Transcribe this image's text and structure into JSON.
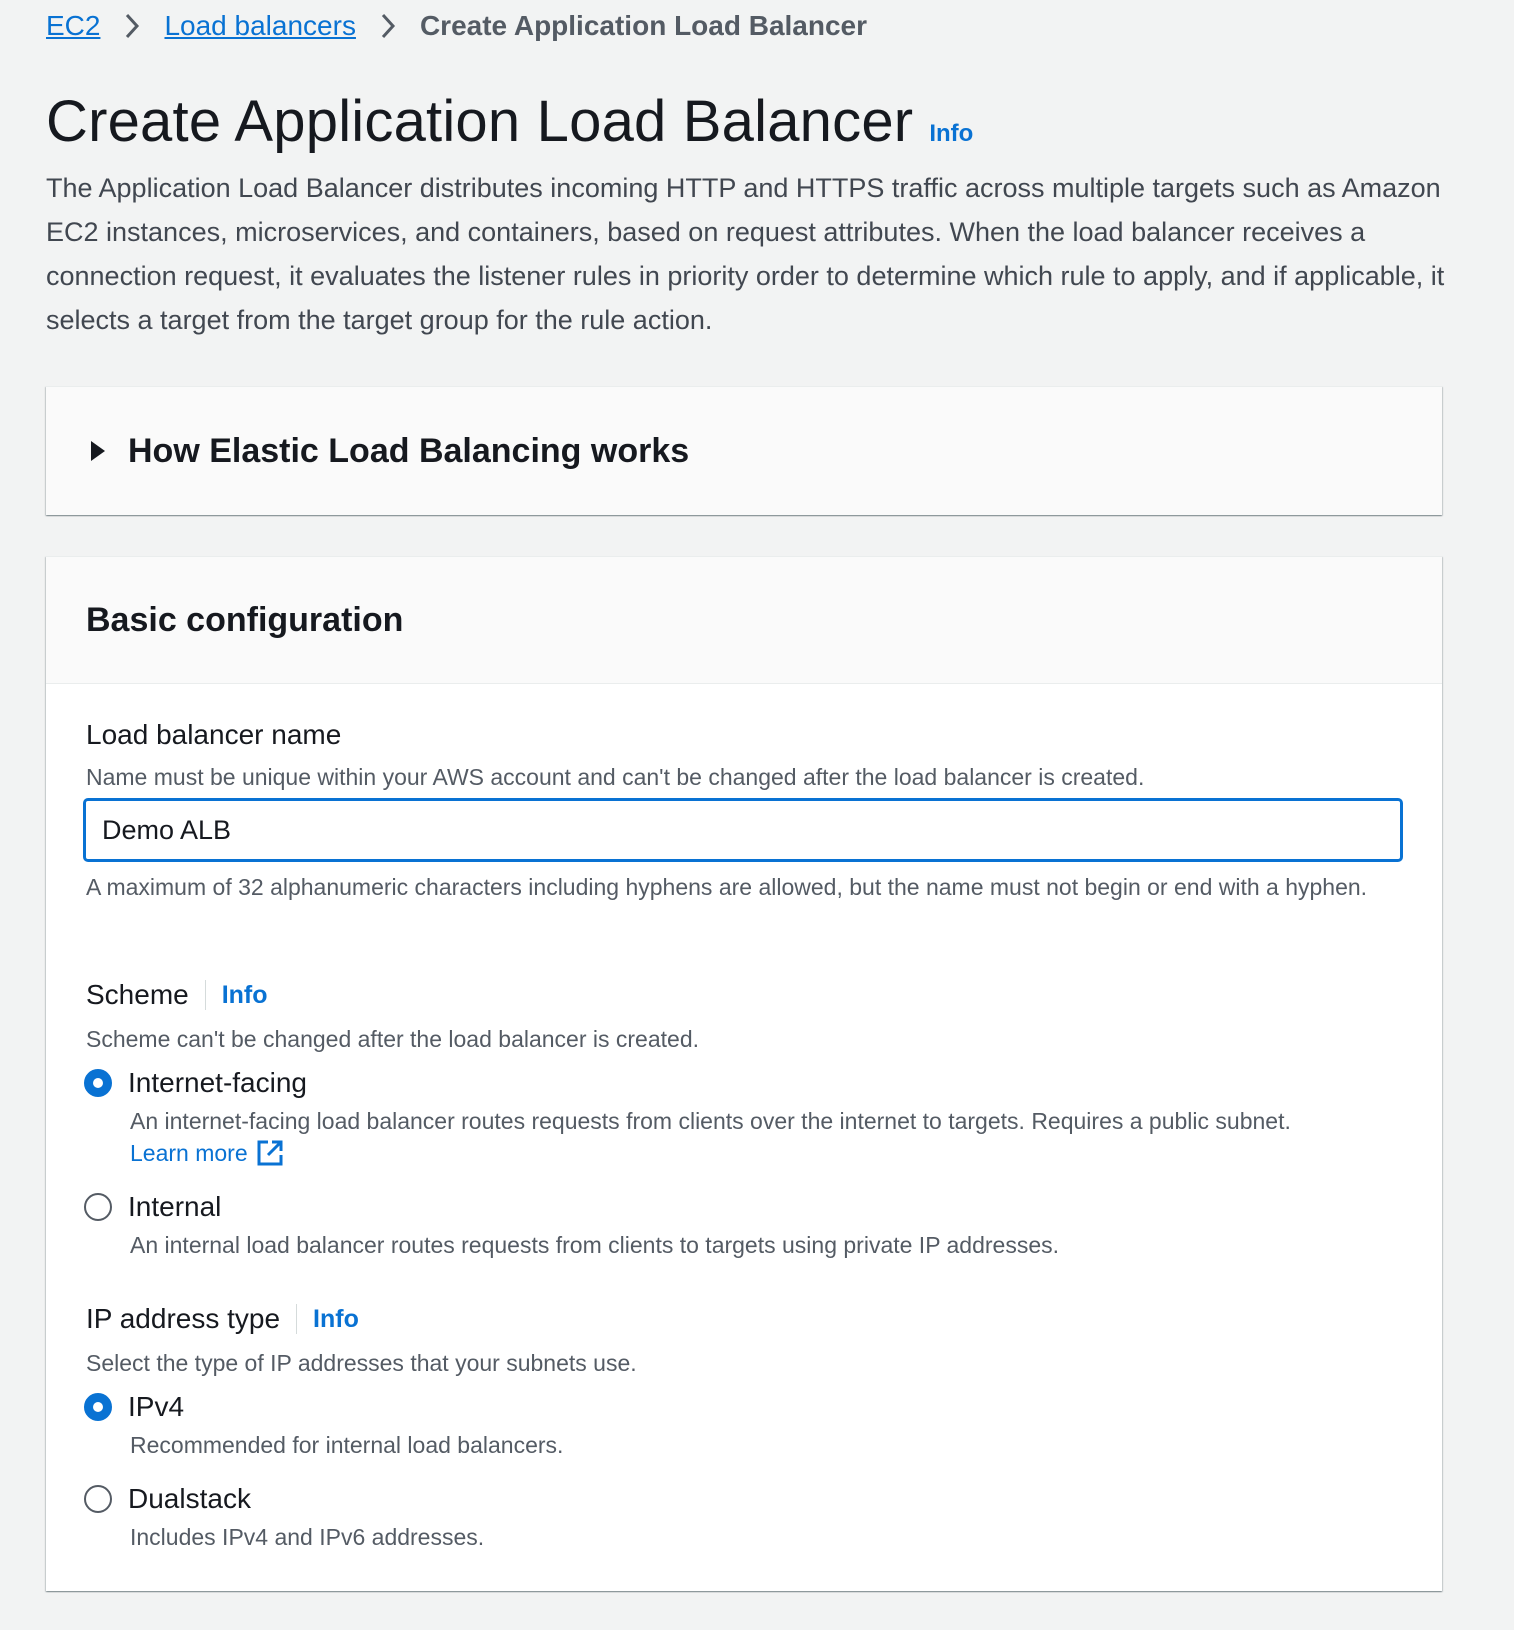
{
  "breadcrumb": {
    "items": [
      {
        "label": "EC2"
      },
      {
        "label": "Load balancers"
      }
    ],
    "current": "Create Application Load Balancer"
  },
  "header": {
    "title": "Create Application Load Balancer",
    "info_label": "Info",
    "description": "The Application Load Balancer distributes incoming HTTP and HTTPS traffic across multiple targets such as Amazon EC2 instances, microservices, and containers, based on request attributes. When the load balancer receives a connection request, it evaluates the listener rules in priority order to determine which rule to apply, and if applicable, it selects a target from the target group for the rule action."
  },
  "how_it_works": {
    "title": "How Elastic Load Balancing works",
    "expanded": false
  },
  "basic_config": {
    "title": "Basic configuration",
    "name_field": {
      "label": "Load balancer name",
      "description": "Name must be unique within your AWS account and can't be changed after the load balancer is created.",
      "value": "Demo ALB",
      "constraint": "A maximum of 32 alphanumeric characters including hyphens are allowed, but the name must not begin or end with a hyphen."
    },
    "scheme": {
      "label": "Scheme",
      "info_label": "Info",
      "description": "Scheme can't be changed after the load balancer is created.",
      "options": [
        {
          "label": "Internet-facing",
          "description": "An internet-facing load balancer routes requests from clients over the internet to targets. Requires a public subnet.",
          "link": "Learn more",
          "selected": true
        },
        {
          "label": "Internal",
          "description": "An internal load balancer routes requests from clients to targets using private IP addresses.",
          "selected": false
        }
      ]
    },
    "ip_type": {
      "label": "IP address type",
      "info_label": "Info",
      "description": "Select the type of IP addresses that your subnets use.",
      "options": [
        {
          "label": "IPv4",
          "description": "Recommended for internal load balancers.",
          "selected": true
        },
        {
          "label": "Dualstack",
          "description": "Includes IPv4 and IPv6 addresses.",
          "selected": false
        }
      ]
    }
  },
  "icons": {
    "breadcrumb_separator": "chevron-right-icon",
    "expander": "caret-right-icon",
    "external_link": "external-link-icon"
  },
  "colors": {
    "accent": "#0972d3",
    "background": "#f2f3f3",
    "text": "#16191f",
    "secondary_text": "#545b64"
  }
}
